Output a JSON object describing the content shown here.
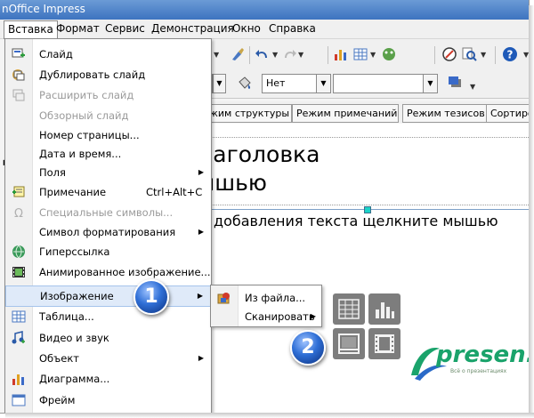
{
  "window": {
    "title": "nOffice Impress"
  },
  "menubar": {
    "insert": "Вставка",
    "format": "Формат",
    "tools": "Сервис",
    "slideshow": "Демонстрация",
    "window": "Окно",
    "help": "Справка"
  },
  "toolbar2": {
    "line_combo_value": "Нет",
    "area_combo_value": ""
  },
  "tabs": [
    "жим структуры",
    "Режим примечаний",
    "Режим тезисов",
    "Сортиро"
  ],
  "slide": {
    "title_line1": "Для добавления заголовка",
    "title_line2": "щелкните мышью",
    "body": "добавления текста щелкните мышью"
  },
  "insert_menu": {
    "items": [
      {
        "label": "Слайд",
        "enabled": true
      },
      {
        "label": "Дублировать слайд",
        "enabled": true
      },
      {
        "label": "Расширить слайд",
        "enabled": false
      },
      {
        "label": "Обзорный слайд",
        "enabled": false
      },
      {
        "label": "Номер страницы...",
        "enabled": true
      },
      {
        "label": "Дата и время...",
        "enabled": true
      },
      {
        "label": "Поля",
        "enabled": true,
        "submenu": true
      },
      {
        "label": "Примечание",
        "enabled": true,
        "shortcut": "Ctrl+Alt+C"
      },
      {
        "label": "Специальные символы...",
        "enabled": false
      },
      {
        "label": "Символ форматирования",
        "enabled": true,
        "submenu": true
      },
      {
        "label": "Гиперссылка",
        "enabled": true
      },
      {
        "label": "Анимированное изображение...",
        "enabled": true
      },
      {
        "label": "Изображение",
        "enabled": true,
        "submenu": true,
        "highlighted": true
      },
      {
        "label": "Таблица...",
        "enabled": true
      },
      {
        "label": "Видео и звук",
        "enabled": true
      },
      {
        "label": "Объект",
        "enabled": true,
        "submenu": true
      },
      {
        "label": "Диаграмма...",
        "enabled": true
      },
      {
        "label": "Фрейм",
        "enabled": true
      }
    ]
  },
  "image_submenu": {
    "from_file": "Из файла...",
    "scan": "Сканировать"
  },
  "badges": {
    "step1": "1",
    "step2": "2"
  },
  "logo": {
    "text": "presen.ru",
    "tagline": "Всё о презентациях"
  },
  "colors": {
    "badge": "#2f6fd6",
    "highlight": "#dfeaf9",
    "logo": "#1aa36b",
    "titlebar": "#3d73c0"
  }
}
